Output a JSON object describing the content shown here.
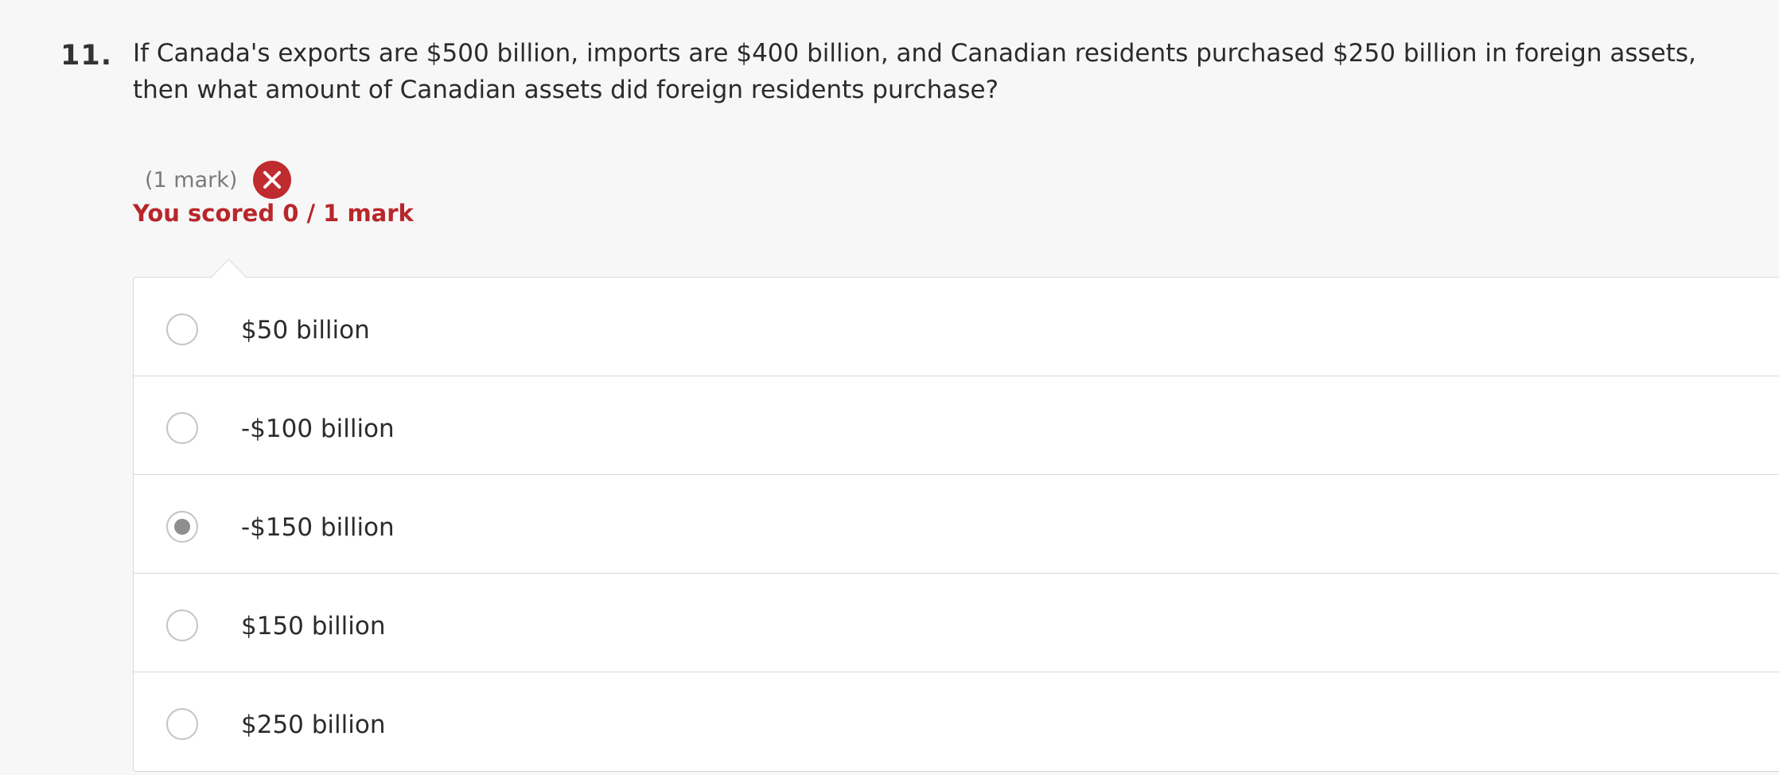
{
  "question": {
    "number": "11.",
    "text": "If Canada's exports are $500 billion, imports are $400 billion, and Canadian residents purchased $250 billion in foreign assets, then what amount of Canadian assets did foreign residents purchase?",
    "marks": "(1 mark)",
    "result_icon": "close-icon",
    "score_text": "You scored 0 / 1 mark"
  },
  "options": [
    {
      "label": "$50 billion",
      "selected": false
    },
    {
      "label": "-$100 billion",
      "selected": false
    },
    {
      "label": "-$150 billion",
      "selected": true
    },
    {
      "label": "$150 billion",
      "selected": false
    },
    {
      "label": "$250 billion",
      "selected": false
    }
  ],
  "colors": {
    "incorrect": "#c02b30",
    "score_text": "#b8262b",
    "background": "#f7f7f7",
    "option_background": "#ffffff"
  }
}
